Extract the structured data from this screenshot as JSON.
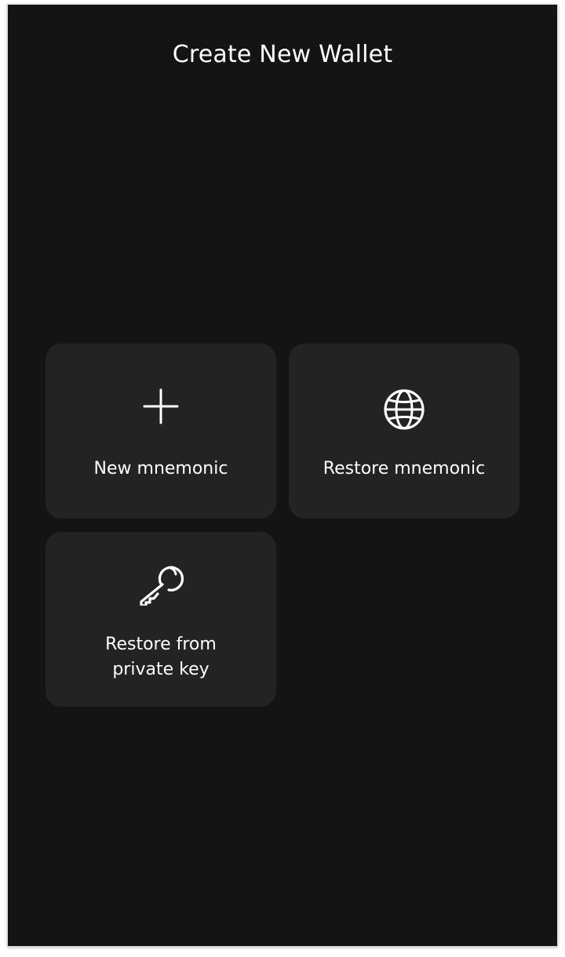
{
  "header": {
    "title": "Create New Wallet"
  },
  "options": [
    {
      "label": "New mnemonic",
      "icon": "plus-icon"
    },
    {
      "label": "Restore mnemonic",
      "icon": "globe-icon"
    },
    {
      "label_line1": "Restore from",
      "label_line2": "private key",
      "icon": "key-icon"
    }
  ],
  "colors": {
    "background": "#141414",
    "card": "#232323",
    "text": "#ffffff"
  }
}
